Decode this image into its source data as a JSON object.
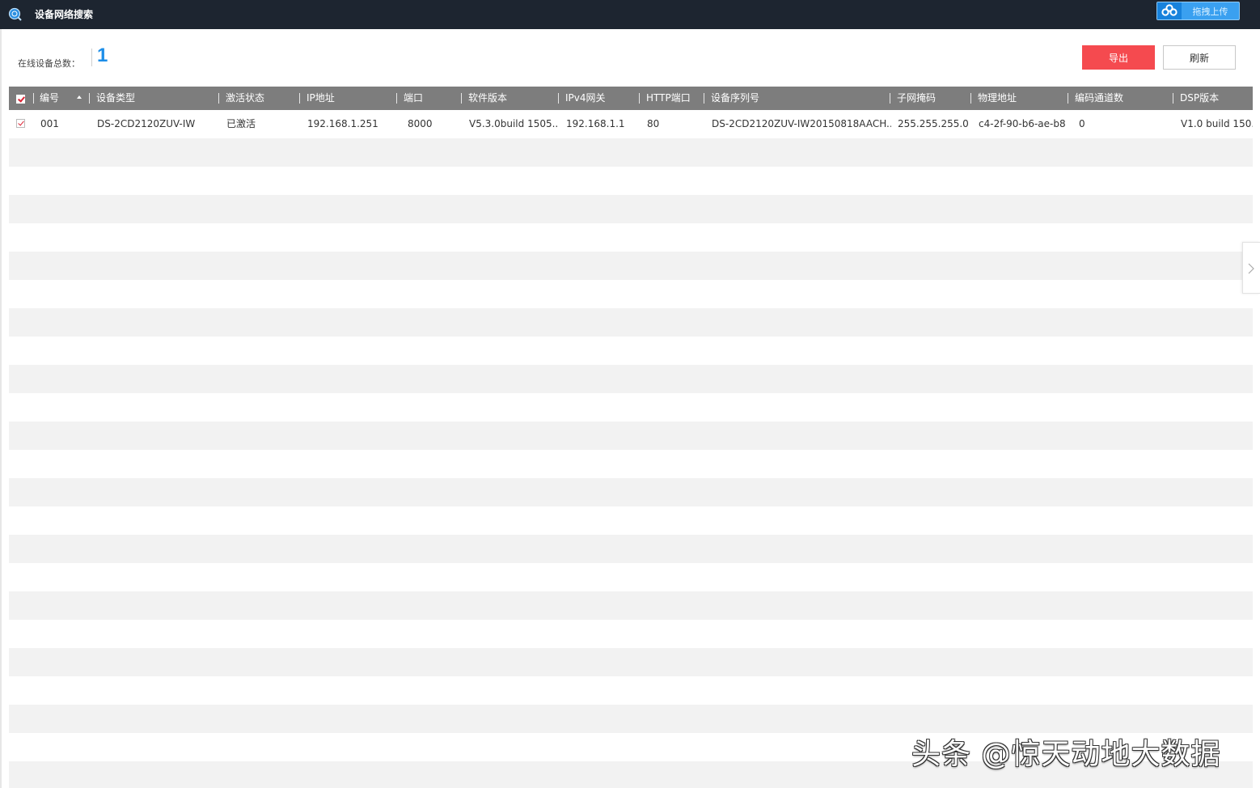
{
  "window": {
    "title": "设备网络搜索",
    "upload_label": "拖拽上传",
    "app_icon": "search-globe-icon",
    "upload_icon": "cloud-icon"
  },
  "summary": {
    "online_total_label": "在线设备总数：",
    "online_total_value": "1"
  },
  "toolbar": {
    "export_label": "导出",
    "refresh_label": "刷新"
  },
  "table": {
    "header_checkbox_checked": true,
    "sort_column": "编号",
    "sort_direction": "ascending",
    "columns": [
      "编号",
      "设备类型",
      "激活状态",
      "IP地址",
      "端口",
      "软件版本",
      "IPv4网关",
      "HTTP端口",
      "设备序列号",
      "子网掩码",
      "物理地址",
      "编码通道数",
      "DSP版本"
    ],
    "rows": [
      {
        "checked": true,
        "cells": [
          "001",
          "DS-2CD2120ZUV-IW",
          "已激活",
          "192.168.1.251",
          "8000",
          "V5.3.0build 1505...",
          "192.168.1.1",
          "80",
          "DS-2CD2120ZUV-IW20150818AACH...",
          "255.255.255.0",
          "c4-2f-90-b6-ae-b8",
          "0",
          "V1.0 build 150..."
        ]
      }
    ]
  },
  "side_panel": {
    "toggle_icon": "chevron-right-icon"
  },
  "watermark": {
    "text": "头条 @惊天动地大数据"
  },
  "colors": {
    "titlebar": "#1d2530",
    "header": "#7d7d7d",
    "export_button": "#f54a4f",
    "total_value": "#1d8ee8",
    "stripe": "#f2f2f2"
  }
}
